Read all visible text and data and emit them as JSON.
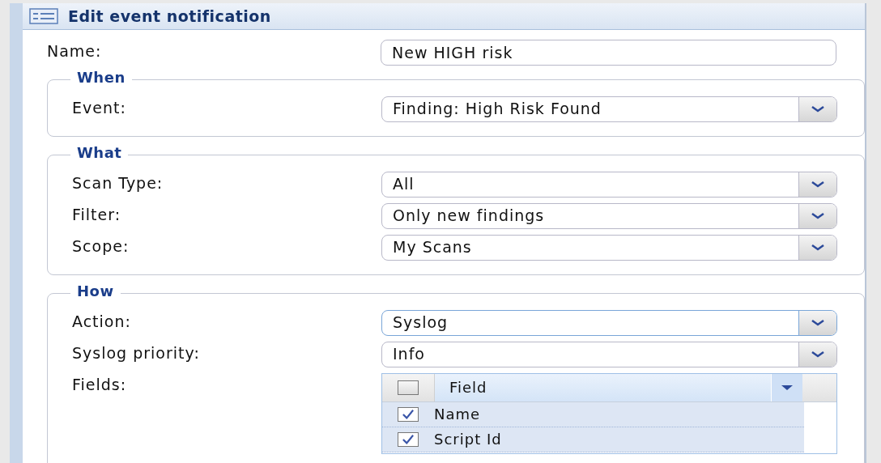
{
  "window": {
    "title": "Edit event notification"
  },
  "name_field": {
    "label": "Name:",
    "value": "New HIGH risk"
  },
  "sections": [
    {
      "legend": "When",
      "fields": [
        {
          "kind": "select",
          "label": "Event:",
          "value": "Finding: High Risk Found",
          "focused": false
        }
      ]
    },
    {
      "legend": "What",
      "fields": [
        {
          "kind": "select",
          "label": "Scan Type:",
          "value": "All",
          "focused": false
        },
        {
          "kind": "select",
          "label": "Filter:",
          "value": "Only new findings",
          "focused": false
        },
        {
          "kind": "select",
          "label": "Scope:",
          "value": "My Scans",
          "focused": false
        }
      ]
    },
    {
      "legend": "How",
      "fields": [
        {
          "kind": "select",
          "label": "Action:",
          "value": "Syslog",
          "focused": true
        },
        {
          "kind": "select",
          "label": "Syslog priority:",
          "value": "Info",
          "focused": false
        },
        {
          "kind": "grid",
          "label": "Fields:",
          "header": {
            "label": "Field",
            "checked": false
          },
          "rows": [
            {
              "label": "Name",
              "checked": true,
              "selected": true
            },
            {
              "label": "Script Id",
              "checked": true,
              "selected": true
            }
          ]
        }
      ]
    }
  ]
}
